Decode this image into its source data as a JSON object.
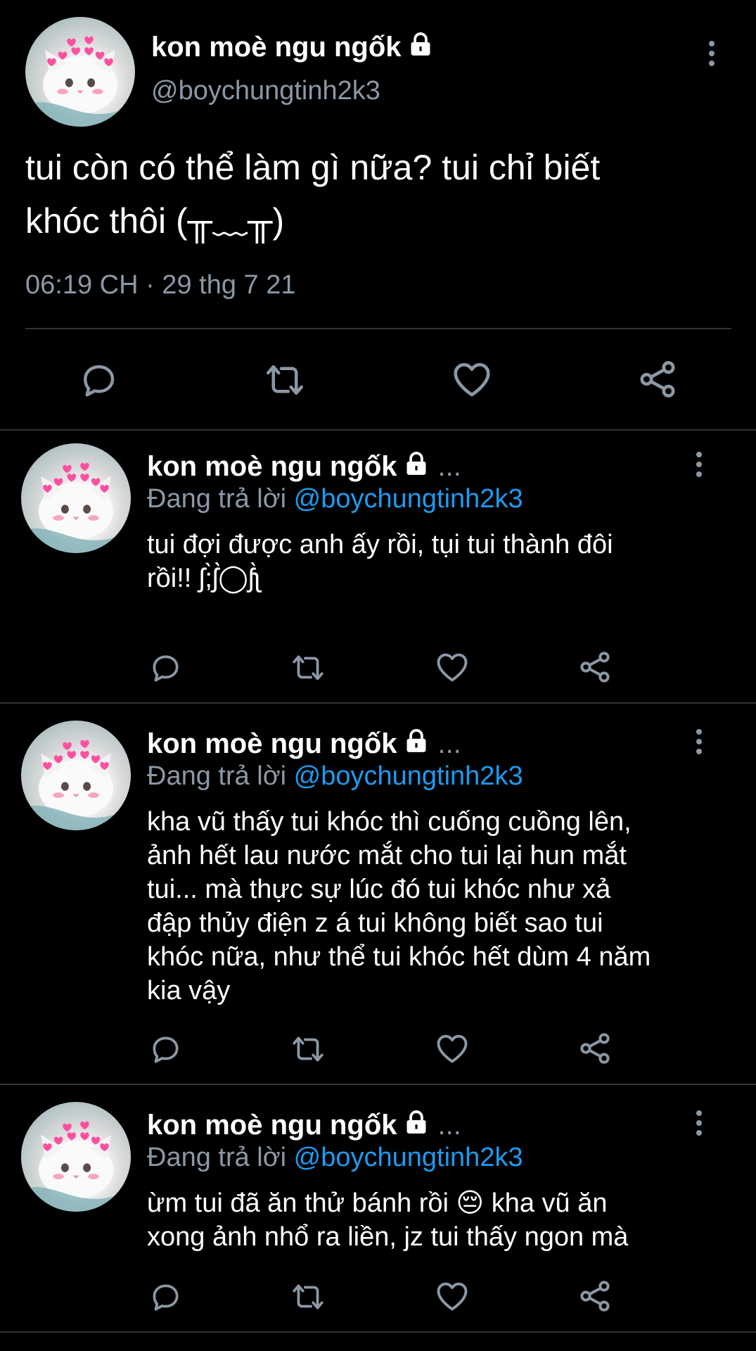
{
  "main_tweet": {
    "name": "kon moè ngu ngốk",
    "handle": "@boychungtinh2k3",
    "text_line1": "tui còn có thể làm gì nữa? tui chỉ biết",
    "text_line2": "khóc thôi (╥﹏╥)",
    "timestamp": "06:19 CH · 29 thg 7 21"
  },
  "replies": [
    {
      "name": "kon moè ngu ngốk",
      "ellipsis": "...",
      "replying_prefix": "Đang trả lời ",
      "replying_to": "@boychungtinh2k3",
      "lines": [
        "tui đợi được anh ấy rồi, tụi tui thành đôi",
        "rồi!! ʃ;̀ʃ̀◯ʃ̀ʅ"
      ]
    },
    {
      "name": "kon moè ngu ngốk",
      "ellipsis": "...",
      "replying_prefix": "Đang trả lời ",
      "replying_to": "@boychungtinh2k3",
      "lines": [
        "kha vũ thấy tui khóc thì cuống cuồng lên,",
        "ảnh hết lau nước mắt cho tui lại hun mắt",
        "tui... mà thực sự lúc đó tui khóc như xả",
        "đập thủy điện z á tui không biết sao tui",
        "khóc nữa, như thể tui khóc hết dùm 4 năm",
        "kia vậy"
      ]
    },
    {
      "name": "kon moè ngu ngốk",
      "ellipsis": "...",
      "replying_prefix": "Đang trả lời ",
      "replying_to": "@boychungtinh2k3",
      "lines": [
        "ừm tui đã ăn thử bánh rồi 😔 kha vũ ăn",
        "xong ảnh nhổ ra liền, jz tui thấy ngon mà"
      ]
    }
  ],
  "icons": [
    "reply-icon",
    "retweet-icon",
    "like-icon",
    "share-icon",
    "lock-icon",
    "more-icon"
  ],
  "colors": {
    "background": "#000000",
    "secondary_text": "#8b98a5",
    "link": "#1d9bf0",
    "divider": "#2f3336"
  }
}
